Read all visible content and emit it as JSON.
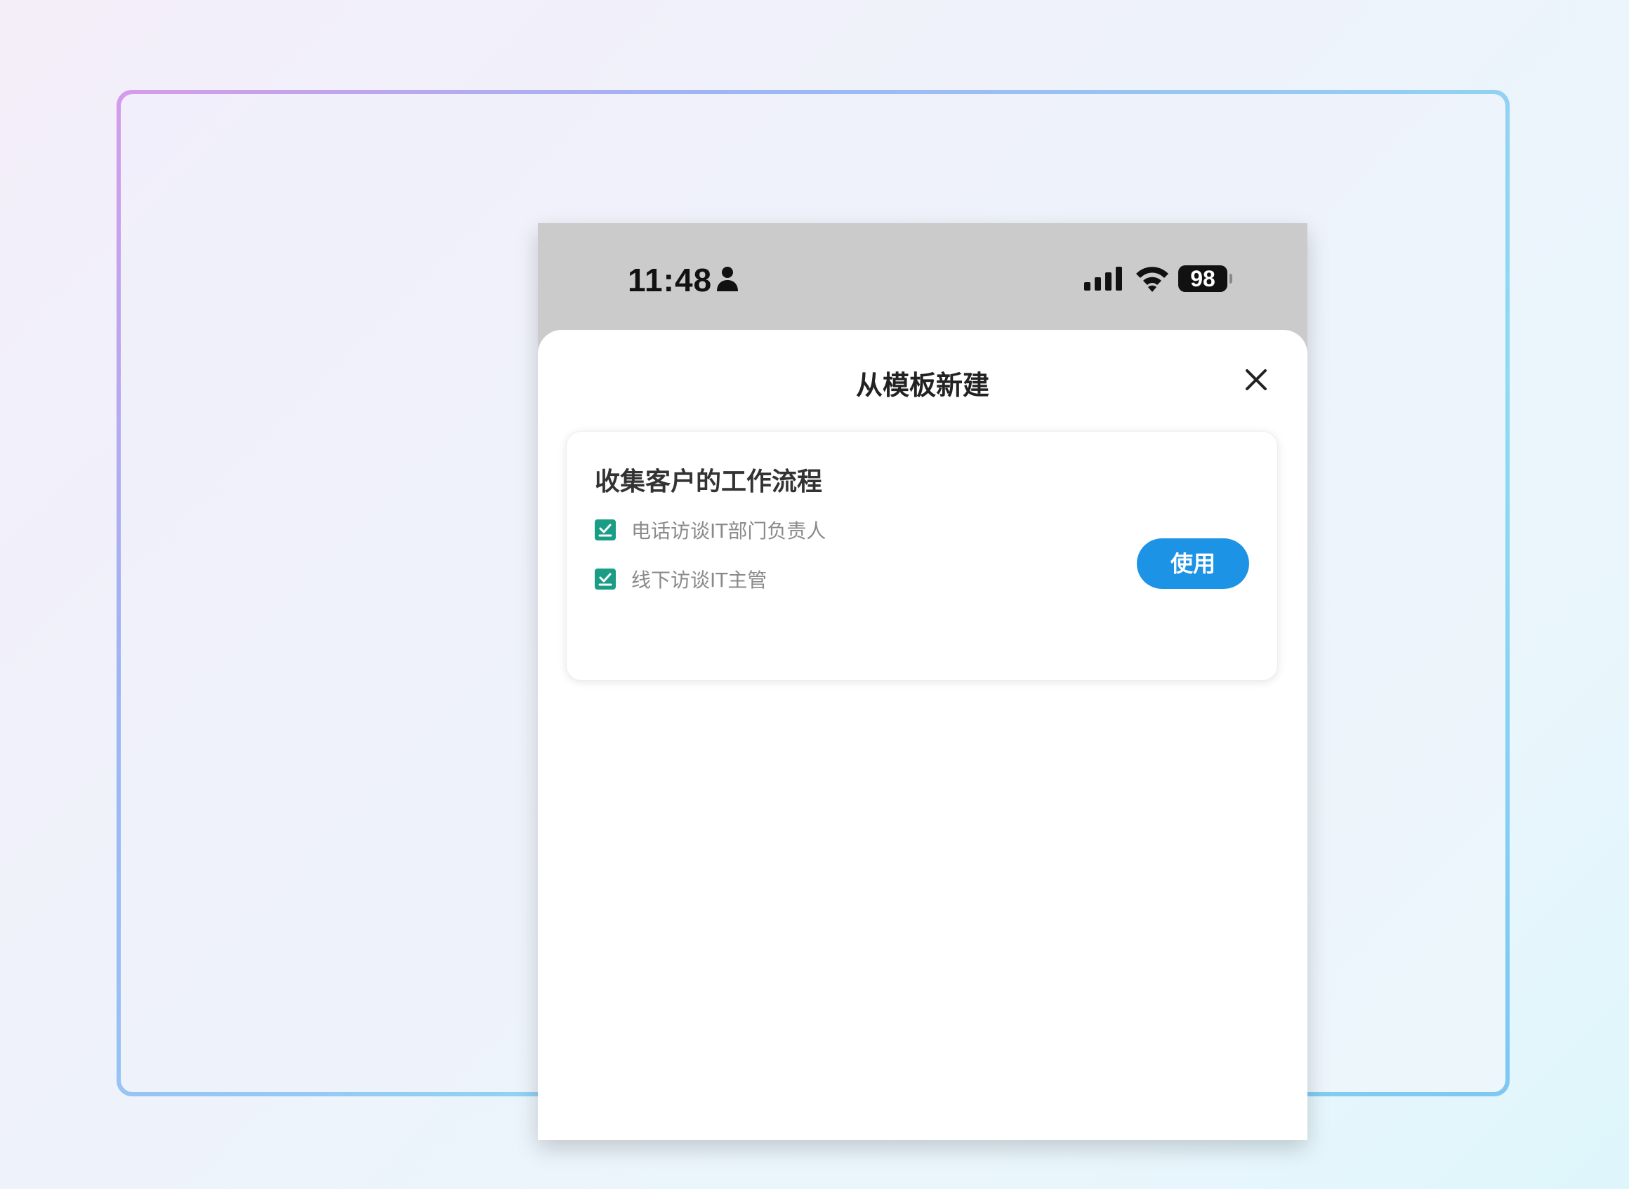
{
  "status_bar": {
    "time": "11:48",
    "battery": "98",
    "icons": [
      "person-icon",
      "signal-icon",
      "wifi-icon",
      "battery-icon"
    ]
  },
  "sheet": {
    "title": "从模板新建",
    "close_icon": "close-icon"
  },
  "template_card": {
    "title": "收集客户的工作流程",
    "steps": [
      {
        "label": "电话访谈IT部门负责人",
        "checked": true
      },
      {
        "label": "线下访谈IT主管",
        "checked": true
      }
    ],
    "use_button_label": "使用"
  },
  "colors": {
    "accent_blue": "#1d93e6",
    "check_green": "#1a9d85",
    "status_bar_gray": "#cbcbcb"
  }
}
